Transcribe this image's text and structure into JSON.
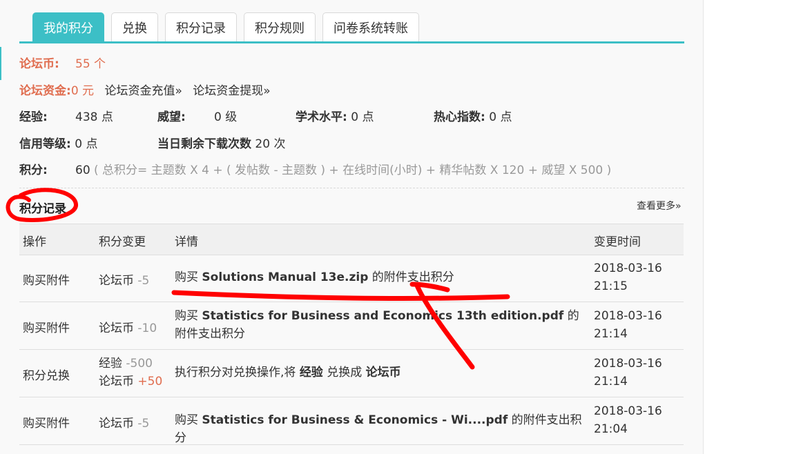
{
  "tabs": [
    {
      "label": "我的积分",
      "active": true
    },
    {
      "label": "兑换",
      "active": false
    },
    {
      "label": "积分记录",
      "active": false
    },
    {
      "label": "积分规则",
      "active": false
    },
    {
      "label": "问卷系统转账",
      "active": false
    }
  ],
  "info": {
    "coin_label": "论坛币:",
    "coin_value": "55 个",
    "fund_label": "论坛资金:",
    "fund_value": "0 元",
    "recharge_link": "论坛资金充值»",
    "withdraw_link": "论坛资金提现»",
    "exp_label": "经验:",
    "exp_value": "438 点",
    "prestige_label": "威望:",
    "prestige_value": "0 级",
    "academic_label": "学术水平:",
    "academic_value": "0 点",
    "enthusiasm_label": "热心指数:",
    "enthusiasm_value": "0 点",
    "credit_label": "信用等级:",
    "credit_value": "0 点",
    "downloads_label": "当日剩余下载次数",
    "downloads_value": "20 次",
    "points_label": "积分:",
    "points_value": "60",
    "points_formula": "( 总积分= 主题数 X 4 + ( 发帖数 - 主题数 ) + 在线时间(小时) + 精华帖数 X 120 + 威望 X 500 )"
  },
  "records": {
    "title": "积分记录",
    "more_link": "查看更多»",
    "headers": [
      "操作",
      "积分变更",
      "详情",
      "变更时间"
    ],
    "rows": [
      {
        "action": "购买附件",
        "change1_label": "论坛币",
        "change1_value": "-5",
        "change2_label": "",
        "change2_value": "",
        "detail_pre": "购买 ",
        "detail_bold": "Solutions Manual 13e.zip",
        "detail_post": " 的附件支出积分",
        "date": "2018-03-16",
        "time": "21:15"
      },
      {
        "action": "购买附件",
        "change1_label": "论坛币",
        "change1_value": "-10",
        "change2_label": "",
        "change2_value": "",
        "detail_pre": "购买 ",
        "detail_bold": "Statistics for Business and Economics 13th edition.pdf",
        "detail_post": " 的附件支出积分",
        "date": "2018-03-16",
        "time": "21:14"
      },
      {
        "action": "积分兑换",
        "change1_label": "经验",
        "change1_value": "-500",
        "change2_label": "论坛币",
        "change2_value": "+50",
        "detail_pre": "执行积分对兑换操作,将 ",
        "detail_bold": "经验",
        "detail_mid": " 兑换成 ",
        "detail_bold2": "论坛币",
        "detail_post": "",
        "date": "2018-03-16",
        "time": "21:14"
      },
      {
        "action": "购买附件",
        "change1_label": "论坛币",
        "change1_value": "-5",
        "change2_label": "",
        "change2_value": "",
        "detail_pre": "购买 ",
        "detail_bold": "Statistics for Business & Economics - Wi....pdf",
        "detail_post": " 的附件支出积分",
        "date": "2018-03-16",
        "time": "21:04"
      }
    ]
  },
  "colors": {
    "accent": "#3cbfc6",
    "red": "#e06d4f",
    "annotation": "#ff0000"
  }
}
